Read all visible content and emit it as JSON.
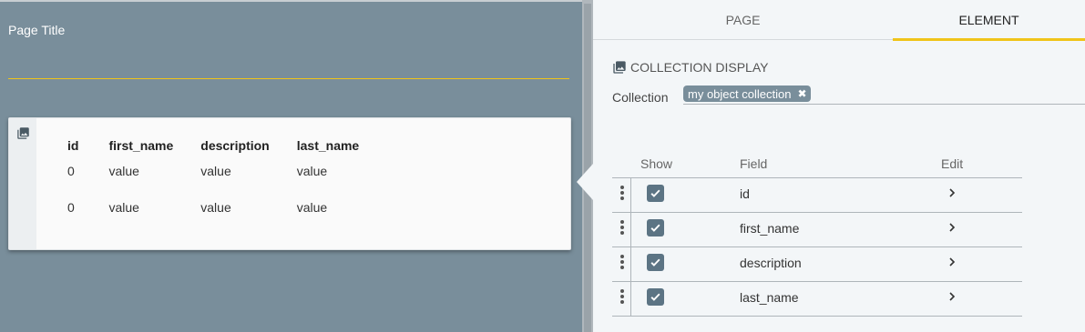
{
  "canvas": {
    "page_title": "Page Title",
    "table": {
      "headers": [
        "id",
        "first_name",
        "description",
        "last_name"
      ],
      "rows": [
        [
          "0",
          "value",
          "value",
          "value"
        ],
        [
          "0",
          "value",
          "value",
          "value"
        ]
      ]
    }
  },
  "panel": {
    "tabs": [
      {
        "label": "PAGE",
        "active": false
      },
      {
        "label": "ELEMENT",
        "active": true
      }
    ],
    "section_title": "COLLECTION DISPLAY",
    "collection": {
      "label": "Collection",
      "chip": "my object collection"
    },
    "grid": {
      "headers": {
        "show": "Show",
        "field": "Field",
        "edit": "Edit"
      },
      "rows": [
        {
          "field": "id",
          "show": true
        },
        {
          "field": "first_name",
          "show": true
        },
        {
          "field": "description",
          "show": true
        },
        {
          "field": "last_name",
          "show": true
        }
      ]
    }
  },
  "icons": {
    "image": "image-icon",
    "drag": "drag-handle-icon",
    "check": "checkmark-icon",
    "chevron": "chevron-right-icon",
    "remove": "close-icon"
  },
  "colors": {
    "canvas_bg": "#798e9b",
    "accent": "#f0c419",
    "checkbox": "#5c7484",
    "panel_bg": "#f3f6f8"
  }
}
